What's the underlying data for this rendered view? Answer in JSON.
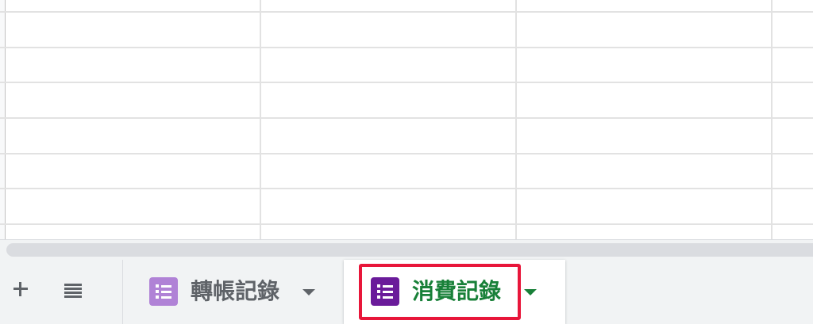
{
  "sheet_tabs": {
    "add_sheet_icon": "plus-icon",
    "all_sheets_icon": "list-icon",
    "tabs": [
      {
        "label": "轉帳記錄",
        "icon": "form-icon",
        "icon_color": "#b082d6",
        "label_color": "#5f6368",
        "active": false
      },
      {
        "label": "消費記錄",
        "icon": "form-icon",
        "icon_color": "#6a1b9a",
        "label_color": "#188038",
        "active": true
      }
    ]
  },
  "highlight": {
    "color": "#e8163a"
  },
  "colors": {
    "gridline": "#e2e2e2",
    "tabbar_background": "#f1f3f4",
    "icon_grey": "#5f6368"
  }
}
